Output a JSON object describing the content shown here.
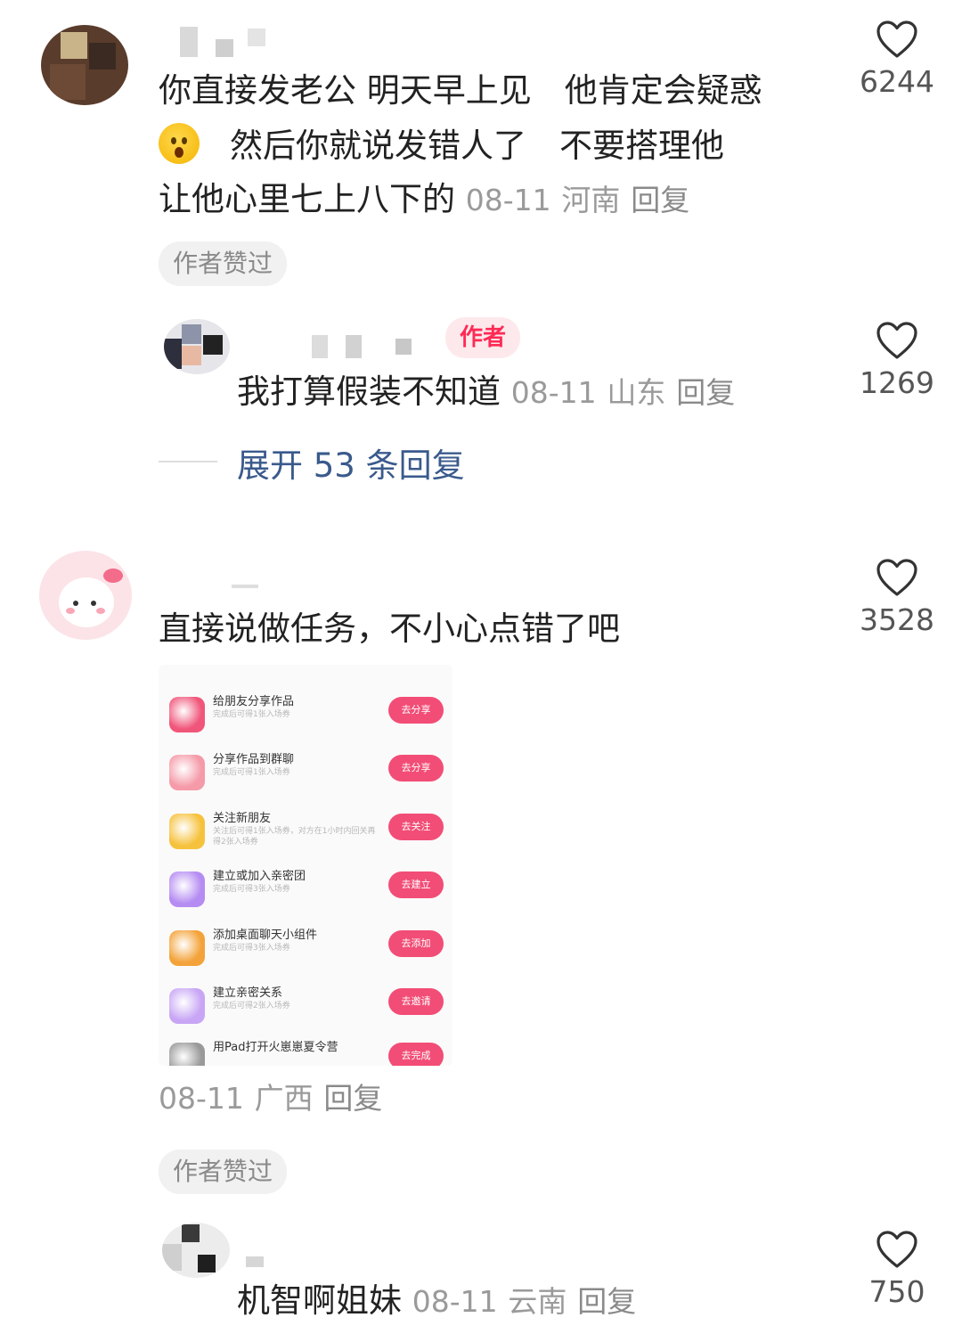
{
  "comments": [
    {
      "text_lines": [
        "你直接发老公 明天早上见　他肯定会疑惑",
        "然后你就说发错人了　不要搭理他",
        "让他心里七上八下的"
      ],
      "emoji": "frowning-face",
      "date": "08-11",
      "location": "河南",
      "reply_label": "回复",
      "likes": "6244",
      "author_liked": "作者赞过",
      "sub_reply": {
        "author_tag": "作者",
        "text": "我打算假装不知道",
        "date": "08-11",
        "location": "山东",
        "reply_label": "回复",
        "likes": "1269"
      },
      "expand_label": "展开 53 条回复"
    },
    {
      "text": "直接说做任务，不小心点错了吧",
      "likes": "3528",
      "date": "08-11",
      "location": "广西",
      "reply_label": "回复",
      "author_liked": "作者赞过",
      "image_tasks": [
        {
          "title": "给朋友分享作品",
          "sub": "完成后可得1张入场券",
          "button": "去分享",
          "color": "#f0567a"
        },
        {
          "title": "分享作品到群聊",
          "sub": "完成后可得1张入场券",
          "button": "去分享",
          "color": "#f59aa8"
        },
        {
          "title": "关注新朋友",
          "sub": "关注后可得1张入场券，对方在1小时内回关再得2张入场券",
          "button": "去关注",
          "color": "#f6c23e"
        },
        {
          "title": "建立或加入亲密团",
          "sub": "完成后可得3张入场券",
          "button": "去建立",
          "color": "#b58cf2"
        },
        {
          "title": "添加桌面聊天小组件",
          "sub": "完成后可得3张入场券",
          "button": "去添加",
          "color": "#f3a33a"
        },
        {
          "title": "建立亲密关系",
          "sub": "完成后可得2张入场券",
          "button": "去邀请",
          "color": "#c8a6f5"
        },
        {
          "title": "用Pad打开火崽崽夏令营",
          "sub": "",
          "button": "去完成",
          "color": "#999999"
        }
      ],
      "sub_reply": {
        "text": "机智啊姐妹",
        "date": "08-11",
        "location": "云南",
        "reply_label": "回复",
        "likes": "750"
      }
    }
  ]
}
